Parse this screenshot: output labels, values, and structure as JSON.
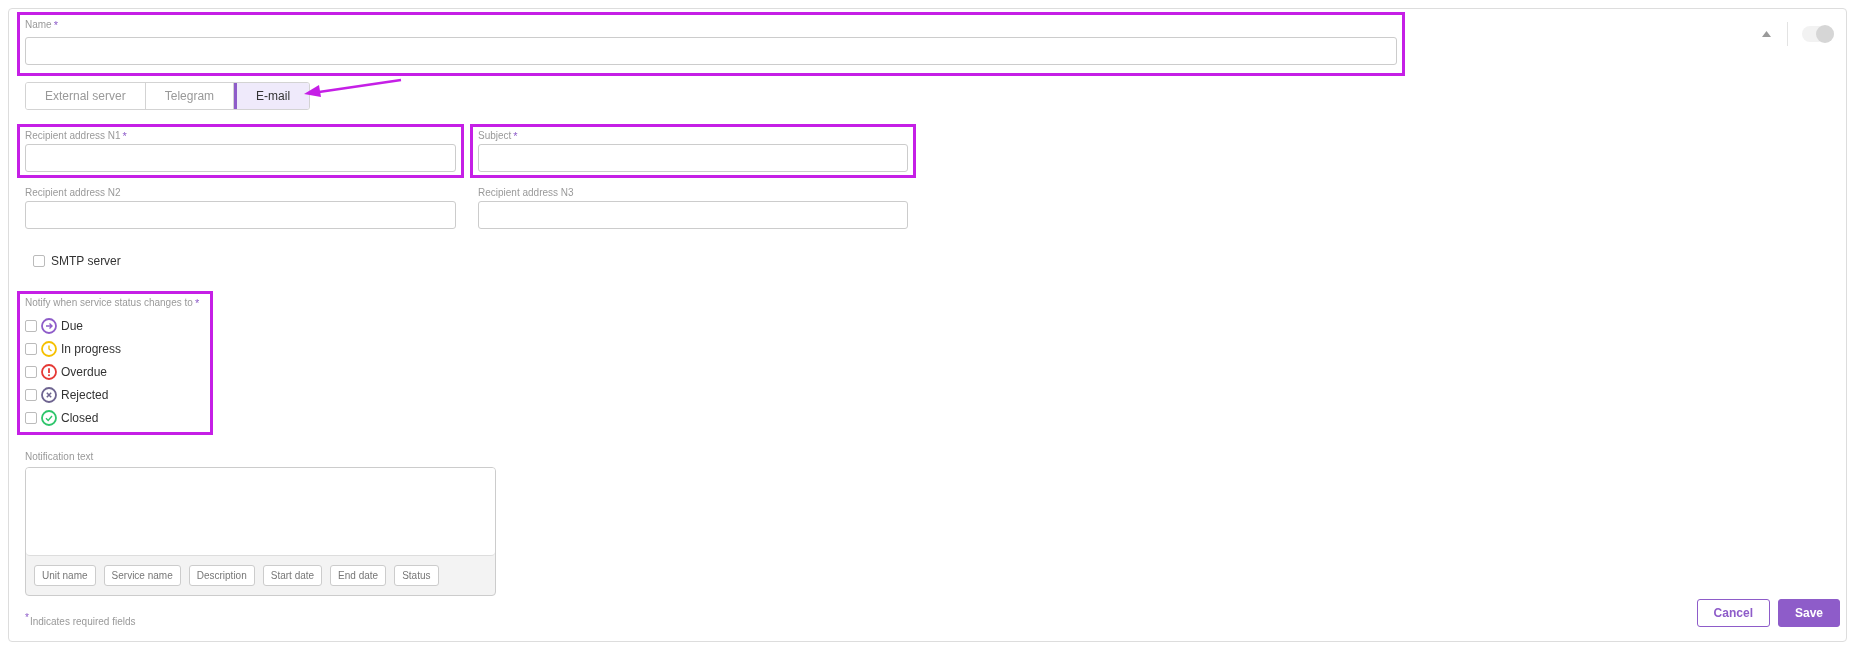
{
  "header": {
    "toggle": {
      "disabled": true
    }
  },
  "name_field": {
    "label": "Name",
    "mark": "*",
    "highlighted": true
  },
  "channel_tabs": {
    "pointer_arrow": true,
    "tabs": [
      {
        "label": "External server",
        "selected": false
      },
      {
        "label": "Telegram",
        "selected": false
      },
      {
        "label": "E-mail",
        "selected": true
      }
    ]
  },
  "fields": [
    {
      "label": "Recipient address N1",
      "mark": "*",
      "highlighted": true
    },
    {
      "label": "Subject",
      "mark": "*",
      "highlighted": true
    },
    {
      "label": "Recipient address N2"
    },
    {
      "label": "Recipient address N3"
    }
  ],
  "smtp": {
    "label": "SMTP server",
    "checked": false
  },
  "statuses": {
    "label": "Notify when service status changes to",
    "mark": "*",
    "highlighted": true,
    "items": [
      {
        "label": "Due",
        "kind": "arrow",
        "color": "#8e5cc9",
        "checked": false
      },
      {
        "label": "In progress",
        "kind": "clock",
        "color": "#f5c000",
        "checked": false
      },
      {
        "label": "Overdue",
        "kind": "alert",
        "color": "#e53935",
        "checked": false
      },
      {
        "label": "Rejected",
        "kind": "cross",
        "color": "#6e6490",
        "checked": false
      },
      {
        "label": "Closed",
        "kind": "check",
        "color": "#2ec56b",
        "checked": false
      }
    ]
  },
  "notification_text": {
    "label": "Notification text",
    "variables": [
      "Unit name",
      "Service name",
      "Description",
      "Start date",
      "End date",
      "Status"
    ]
  },
  "footnote": {
    "mark": "*",
    "text": "Indicates required fields"
  },
  "buttons": [
    {
      "label": "Cancel",
      "kind": "secondary"
    },
    {
      "label": "Save",
      "kind": "primary"
    }
  ]
}
